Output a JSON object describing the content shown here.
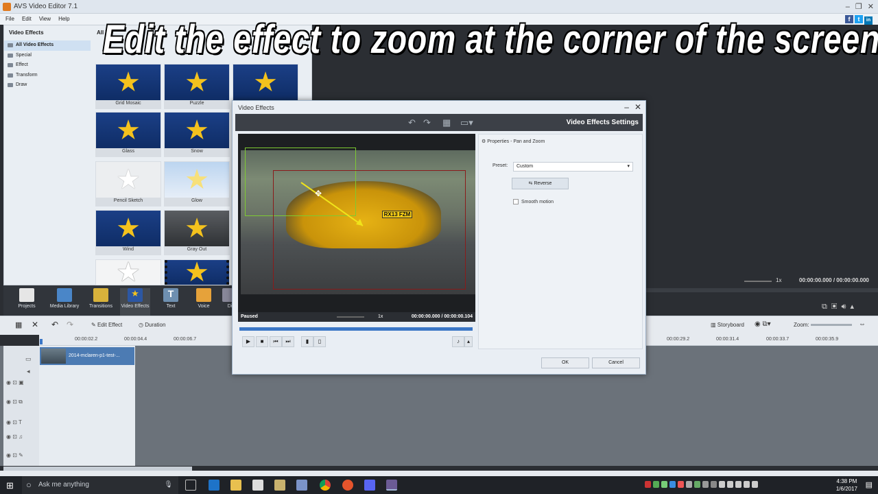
{
  "app": {
    "title": "AVS Video Editor 7.1",
    "menu": [
      "File",
      "Edit",
      "View",
      "Help"
    ],
    "social": [
      "f",
      "t",
      "in"
    ]
  },
  "caption": "Edit the effect to zoom at the corner of the screen",
  "effects_panel": {
    "header": "Video Effects",
    "header2": "All V",
    "categories": [
      "All Video Effects",
      "Special",
      "Effect",
      "Transform",
      "Draw"
    ],
    "thumbs": [
      "Grid Mosaic",
      "Puzzle",
      "",
      "Glass",
      "Snow",
      "Pencil Sketch",
      "Glow",
      "Wind",
      "Gray Out",
      "",
      ""
    ]
  },
  "toolbar": {
    "items": [
      "Projects",
      "Media Library",
      "Transitions",
      "Video Effects",
      "Text",
      "Voice",
      "Di"
    ]
  },
  "edit_bar": {
    "edit_effect": "Edit Effect",
    "duration": "Duration",
    "storyboard": "Storyboard",
    "zoom": "Zoom:"
  },
  "ruler_ticks": [
    "00:00:02.2",
    "00:00:04.4",
    "00:00:06.7",
    "00:00:29.2",
    "00:00:31.4",
    "00:00:33.7",
    "00:00:35.9"
  ],
  "right_preview": {
    "speed": "1x",
    "time": "00:00:00.000 / 00:00:00.000"
  },
  "clip": {
    "name": "2014-mclaren-p1-test-..."
  },
  "dialog": {
    "title": "Video Effects",
    "header": "Video Effects Settings",
    "status": "Paused",
    "speed": "1x",
    "time": "00:00:00.000  /  00:00:00.104",
    "plate": "RX13 FZM",
    "properties": "Properties - Pan and Zoom",
    "preset_label": "Preset:",
    "preset_value": "Custom",
    "reverse": "Reverse",
    "smooth": "Smooth motion",
    "ok": "OK",
    "cancel": "Cancel"
  },
  "taskbar": {
    "search": "Ask me anything",
    "time": "4:38 PM",
    "date": "1/6/2017"
  }
}
